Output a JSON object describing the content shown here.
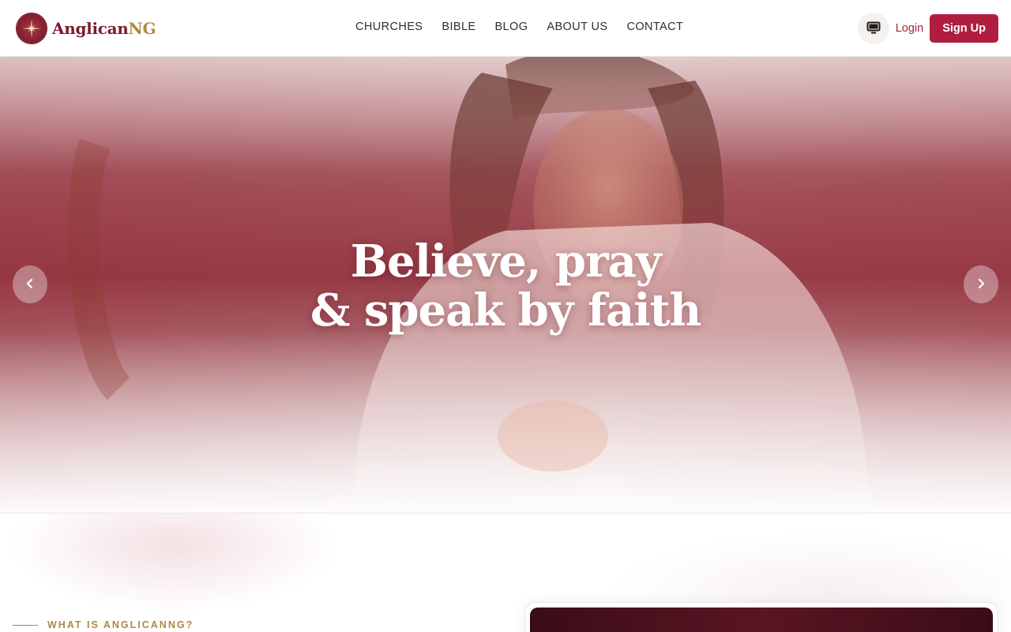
{
  "brand": {
    "name_part1": "Anglican",
    "name_part2": "NG"
  },
  "nav": {
    "items": [
      {
        "label": "CHURCHES"
      },
      {
        "label": "BIBLE"
      },
      {
        "label": "BLOG"
      },
      {
        "label": "ABOUT US"
      },
      {
        "label": "CONTACT"
      }
    ]
  },
  "header_actions": {
    "theme_icon": "monitor-icon",
    "login_label": "Login",
    "signup_label": "Sign Up"
  },
  "hero": {
    "title_line1": "Believe, pray",
    "title_line2": "& speak by faith",
    "prev_icon": "chevron-left-icon",
    "next_icon": "chevron-right-icon"
  },
  "intro": {
    "eyebrow": "WHAT IS ANGLICANNG?"
  },
  "colors": {
    "brand_maroon": "#7a1d2e",
    "brand_gold": "#b08a3e",
    "accent_red": "#b01e3f"
  }
}
